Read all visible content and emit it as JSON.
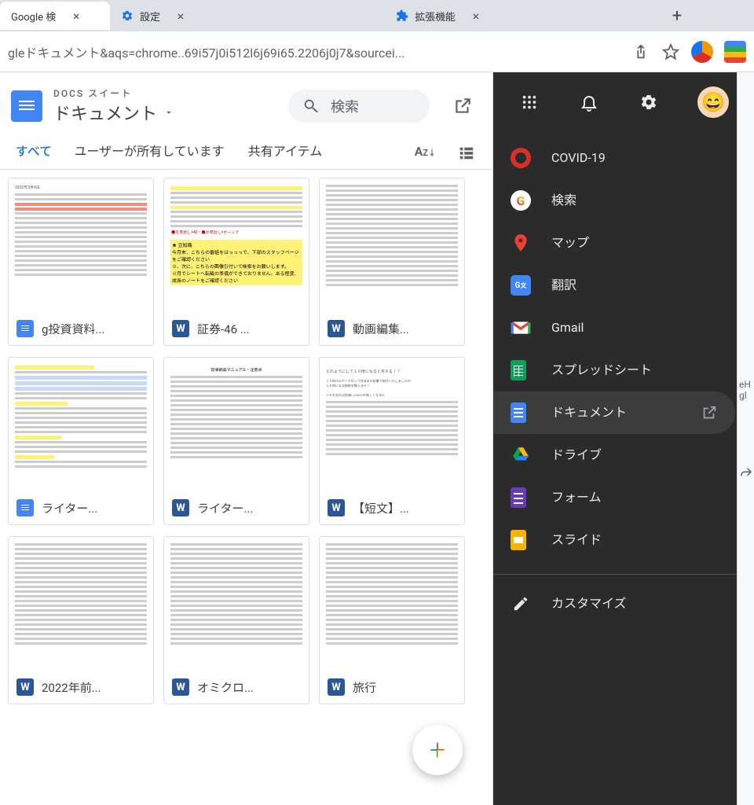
{
  "browser": {
    "tabs": [
      {
        "label": "Google 検",
        "favicon_color": "#fff"
      },
      {
        "label": "設定",
        "icon": "gear",
        "favicon_color": "#1a73e8"
      },
      {
        "label": "拡張機能",
        "icon": "puzzle",
        "favicon_color": "#1a73e8"
      }
    ],
    "url": "gleドキュメント&aqs=chrome..69i57j0i512l6j69i65.2206j0j7&sourcei..."
  },
  "docs": {
    "suite": "DOCS スイート",
    "name": "ドキュメント",
    "search_placeholder": "検索",
    "tabs": {
      "all": "すべて",
      "owned": "ユーザーが所有しています",
      "shared": "共有アイテム"
    },
    "files": [
      {
        "icon": "docs",
        "label": "g投資資料...",
        "thumb": "red"
      },
      {
        "icon": "word",
        "label": "証券-46   ...",
        "thumb": "yellow"
      },
      {
        "icon": "word",
        "label": "動画編集...",
        "thumb": "text"
      },
      {
        "icon": "docs",
        "label": "ライター...",
        "thumb": "bluehl"
      },
      {
        "icon": "word",
        "label": "ライター...",
        "thumb": "textc"
      },
      {
        "icon": "word",
        "label": "【短文】...",
        "thumb": "heading"
      },
      {
        "icon": "word",
        "label": "2022年前...",
        "thumb": "text"
      },
      {
        "icon": "word",
        "label": "オミクロ...",
        "thumb": "text"
      },
      {
        "icon": "word",
        "label": "旅行",
        "thumb": "text"
      }
    ]
  },
  "panel": {
    "items": [
      {
        "icon_bg": "#d93025",
        "icon_txt": "",
        "label": "COVID-19",
        "shape": "rec"
      },
      {
        "icon_bg": "#fff",
        "label": "検索",
        "shape": "g"
      },
      {
        "icon_bg": "#0b57d0",
        "label": "マップ",
        "shape": "pin"
      },
      {
        "icon_bg": "#4285f4",
        "label": "翻訳",
        "shape": "translate"
      },
      {
        "icon_bg": "",
        "label": "Gmail",
        "shape": "gmail"
      },
      {
        "icon_bg": "#0f9d58",
        "label": "スプレッドシート",
        "shape": "sheet"
      },
      {
        "icon_bg": "#4285f4",
        "label": "ドキュメント",
        "shape": "doc",
        "selected": true,
        "open_new": true
      },
      {
        "icon_bg": "",
        "label": "ドライブ",
        "shape": "drive"
      },
      {
        "icon_bg": "#673ab7",
        "label": "フォーム",
        "shape": "form"
      },
      {
        "icon_bg": "#f4b400",
        "label": "スライド",
        "shape": "slide"
      }
    ],
    "customize": "カスタマイズ"
  },
  "right_strip": {
    "text": "eH\ngl"
  }
}
